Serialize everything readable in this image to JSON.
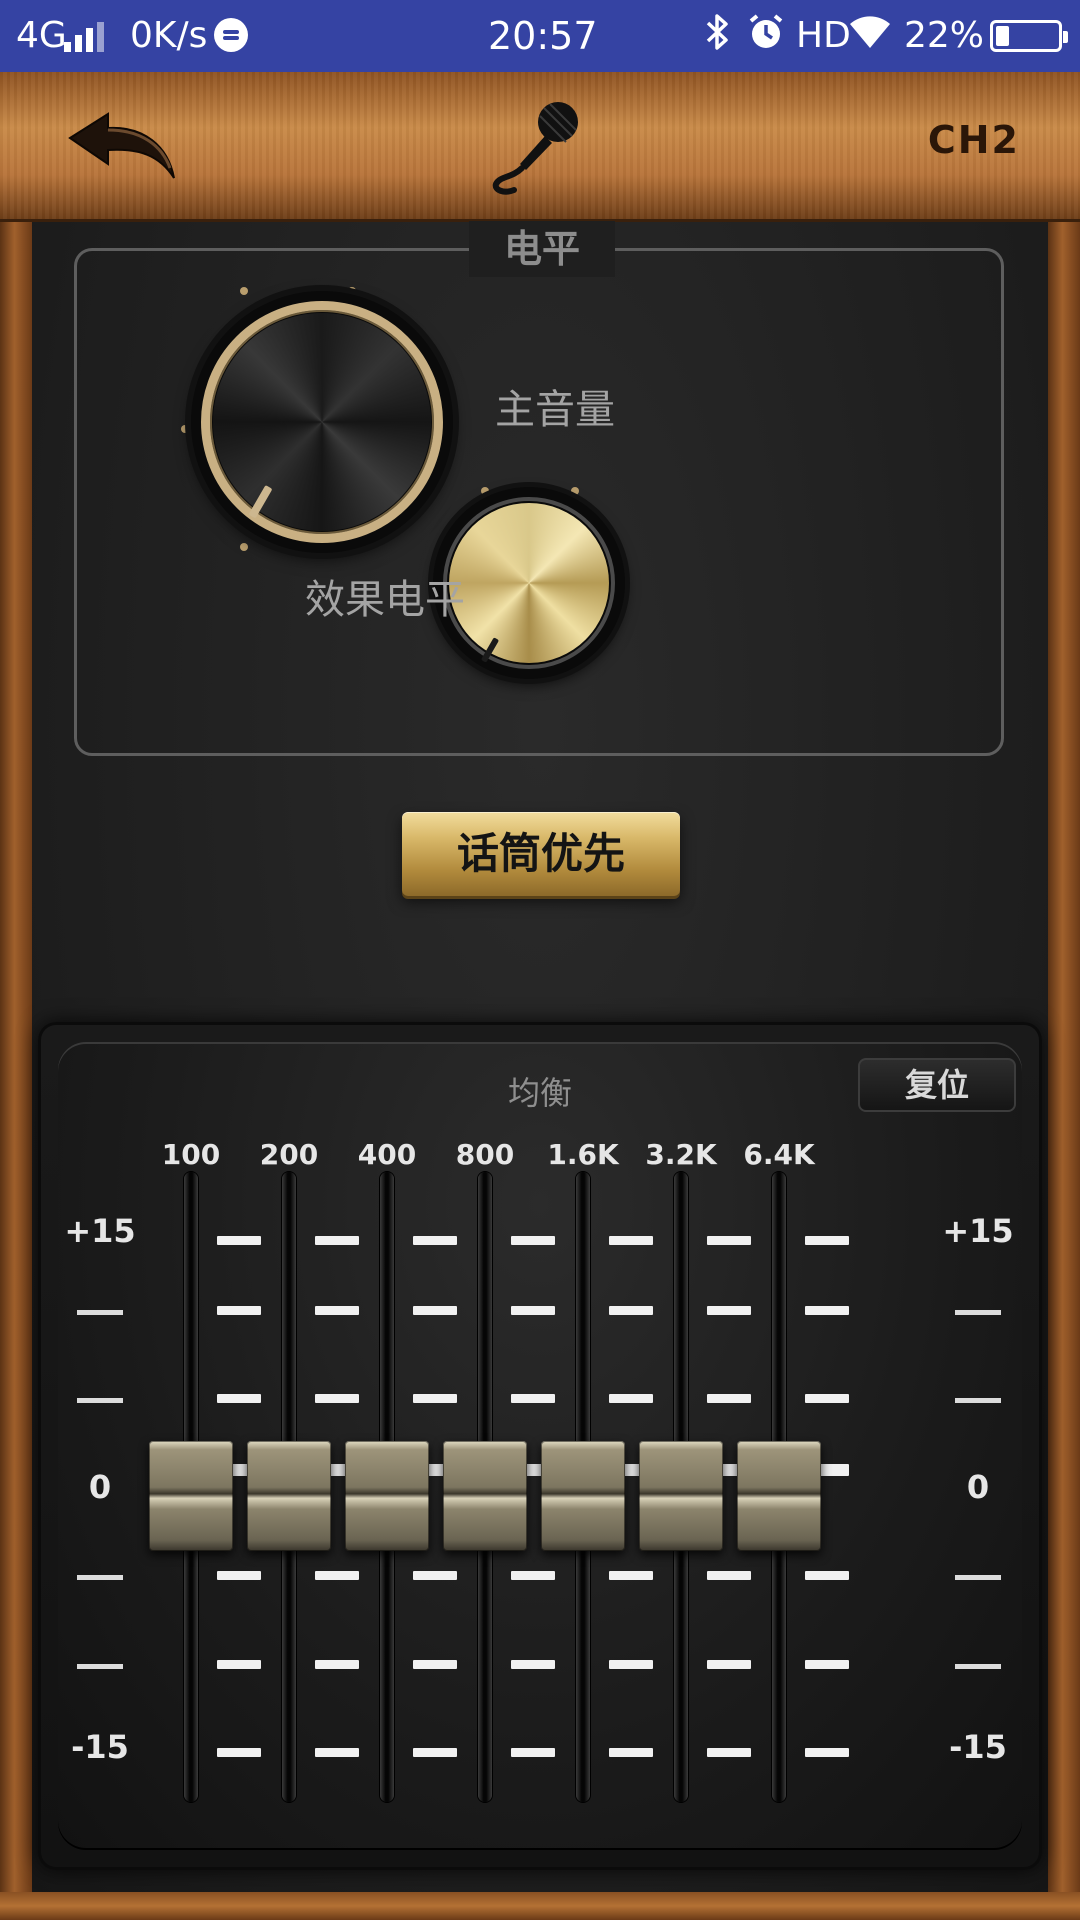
{
  "status_bar": {
    "network": "4G",
    "speed": "0K/s",
    "time": "20:57",
    "hd": "HD",
    "battery_pct": "22%",
    "battery_level": 0.22,
    "icons": [
      "signal-icon",
      "message-icon",
      "bluetooth-icon",
      "alarm-icon",
      "wifi-icon",
      "battery-icon"
    ]
  },
  "header": {
    "icons": [
      "back-arrow-icon",
      "microphone-icon"
    ],
    "channel": "CH2"
  },
  "level": {
    "title": "电平",
    "master_label": "主音量",
    "effect_label": "效果电平"
  },
  "mic_priority_label": "话筒优先",
  "eq": {
    "title": "均衡",
    "reset_label": "复位",
    "scale": {
      "top": "+15",
      "zero": "0",
      "bottom": "-15"
    },
    "bands": [
      {
        "freq": "100",
        "gain": 0
      },
      {
        "freq": "200",
        "gain": 0
      },
      {
        "freq": "400",
        "gain": 0
      },
      {
        "freq": "800",
        "gain": 0
      },
      {
        "freq": "1.6K",
        "gain": 0
      },
      {
        "freq": "3.2K",
        "gain": 0
      },
      {
        "freq": "6.4K",
        "gain": 0
      }
    ]
  },
  "colors": {
    "status_bar": "#3543a3",
    "wood": "#b8743a",
    "gold": "#d9b96a",
    "panel": "#1d1d1d"
  }
}
